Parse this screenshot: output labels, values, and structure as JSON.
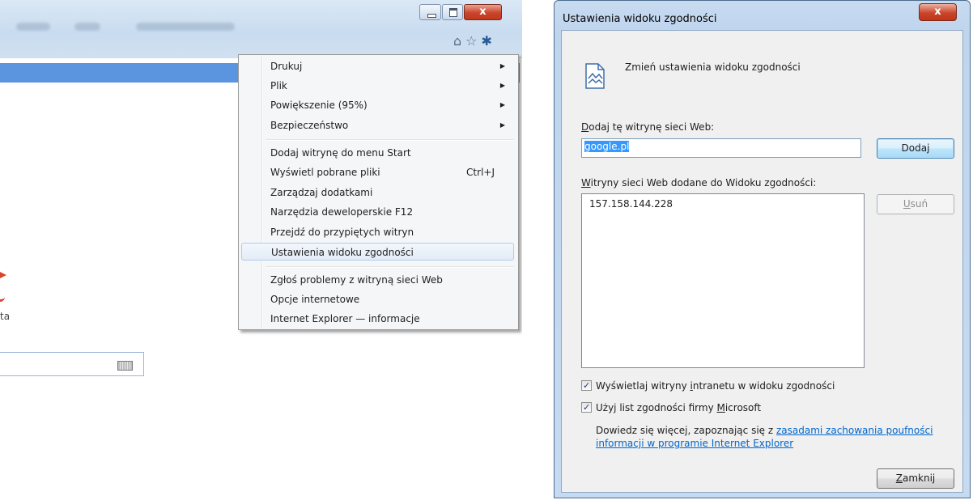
{
  "browser": {
    "window_controls": {
      "close_symbol": "x"
    },
    "icons": [
      "home-icon",
      "star-icon",
      "gear-icon"
    ],
    "partial_text": "ta"
  },
  "menu": {
    "items": [
      {
        "label": "Drukuj",
        "submenu": true
      },
      {
        "label": "Plik",
        "submenu": true
      },
      {
        "label": "Powiększenie (95%)",
        "submenu": true
      },
      {
        "label": "Bezpieczeństwo",
        "submenu": true
      },
      {
        "label": "Dodaj witrynę do menu Start"
      },
      {
        "label": "Wyświetl pobrane pliki",
        "shortcut": "Ctrl+J"
      },
      {
        "label": "Zarządzaj dodatkami"
      },
      {
        "label": "Narzędzia deweloperskie F12"
      },
      {
        "label": "Przejdź do przypiętych witryn"
      },
      {
        "label": "Ustawienia widoku zgodności",
        "highlighted": true
      },
      {
        "label": "Zgłoś problemy z witryną sieci Web"
      },
      {
        "label": "Opcje internetowe"
      },
      {
        "label": "Internet Explorer — informacje"
      }
    ]
  },
  "dialog": {
    "title": "Ustawienia widoku zgodności",
    "close_symbol": "x",
    "header": "Zmień ustawienia widoku zgodności",
    "add_site_label_accel": "D",
    "add_site_label_rest": "odaj tę witrynę sieci Web:",
    "add_site_value": "google.pl",
    "add_button": "Dodaj",
    "sites_label_accel": "W",
    "sites_label_rest": "itryny sieci Web dodane do Widoku zgodności:",
    "sites": [
      "157.158.144.228"
    ],
    "remove_button_accel": "U",
    "remove_button_rest": "suń",
    "checkbox_intranet_pre": "Wyświetlaj witryny ",
    "checkbox_intranet_accel": "i",
    "checkbox_intranet_post": "ntranetu w widoku zgodności",
    "checkbox_intranet_checked": true,
    "checkbox_microsoft_pre": "Użyj list zgodności firmy ",
    "checkbox_microsoft_accel": "M",
    "checkbox_microsoft_post": "icrosoft",
    "checkbox_microsoft_checked": true,
    "info_text": "Dowiedz się więcej, zapoznając się z ",
    "info_link": "zasadami zachowania poufności informacji w programie Internet Explorer",
    "close_button_accel": "Z",
    "close_button_rest": "amknij"
  }
}
